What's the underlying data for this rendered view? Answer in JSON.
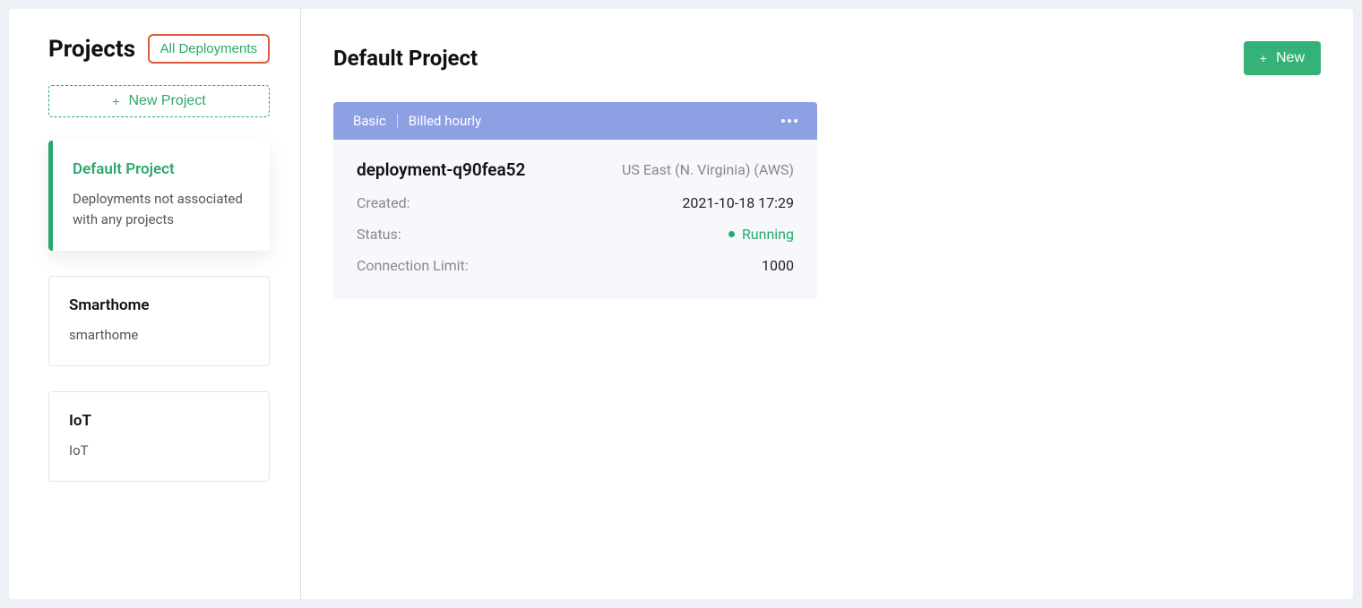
{
  "sidebar": {
    "title": "Projects",
    "all_deployments_label": "All Deployments",
    "new_project_label": "New Project",
    "projects": [
      {
        "name": "Default Project",
        "desc": "Deployments not associated with any projects",
        "active": true
      },
      {
        "name": "Smarthome",
        "desc": "smarthome",
        "active": false
      },
      {
        "name": "IoT",
        "desc": "IoT",
        "active": false
      }
    ]
  },
  "main": {
    "title": "Default Project",
    "new_label": "New"
  },
  "deployment": {
    "tier": "Basic",
    "billing": "Billed hourly",
    "name": "deployment-q90fea52",
    "region": "US East (N. Virginia) (AWS)",
    "created_label": "Created:",
    "created_value": "2021-10-18 17:29",
    "status_label": "Status:",
    "status_value": "Running",
    "connlimit_label": "Connection Limit:",
    "connlimit_value": "1000"
  }
}
